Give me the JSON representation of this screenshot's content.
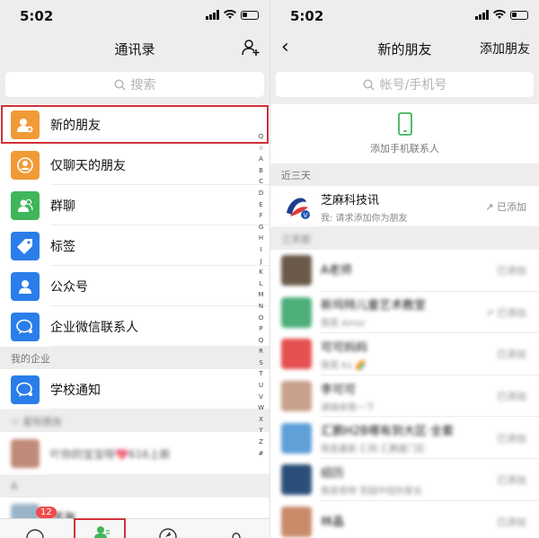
{
  "left": {
    "status_time": "5:02",
    "title": "通讯录",
    "search_placeholder": "搜索",
    "items": [
      {
        "label": "新的朋友",
        "color": "#f19a38"
      },
      {
        "label": "仅聊天的朋友",
        "color": "#f19a38"
      },
      {
        "label": "群聊",
        "color": "#3fb65a"
      },
      {
        "label": "标签",
        "color": "#2b7de9"
      },
      {
        "label": "公众号",
        "color": "#2b7de9"
      },
      {
        "label": "企业微信联系人",
        "color": "#2b7de9"
      }
    ],
    "section_company": "我的企业",
    "company_item": "学校通知",
    "section_starred": "☆ 星标朋友",
    "starred_item": "吖你的宝宝呀💖616上新",
    "section_a": "A",
    "a_item": "洱海",
    "alphabet": [
      "Q",
      "☆",
      "A",
      "B",
      "C",
      "D",
      "E",
      "F",
      "G",
      "H",
      "I",
      "J",
      "K",
      "L",
      "M",
      "N",
      "O",
      "P",
      "Q",
      "R",
      "S",
      "T",
      "U",
      "V",
      "W",
      "X",
      "Y",
      "Z",
      "#"
    ],
    "badge": "12"
  },
  "right": {
    "status_time": "5:02",
    "back": "‹",
    "title": "新的朋友",
    "action": "添加朋友",
    "search_placeholder": "帐号/手机号",
    "add_phone_label": "添加手机联系人",
    "section_recent": "近三天",
    "recent": {
      "name": "芝麻科技讯",
      "msg": "我: 请求添加你为朋友",
      "status": "↗ 已添加"
    },
    "section_older": "三天前",
    "older": [
      {
        "name": "A老师",
        "msg": "",
        "status": "已添加",
        "color": "#6b5a4a"
      },
      {
        "name": "新坞特儿童艺术教室",
        "msg": "我是 Amor",
        "status": "↗ 已添加",
        "color": "#4caf7a"
      },
      {
        "name": "可可妈妈",
        "msg": "我是 Ks 🌈",
        "status": "已添加",
        "color": "#e55050"
      },
      {
        "name": "李可可",
        "msg": "请接收我一下",
        "status": "已添加",
        "color": "#c9a08a"
      },
      {
        "name": "汇鹏H2B哪有到大区·全套",
        "msg": "我是鑫联 汇网 汇鹏厦门区",
        "status": "已添加",
        "color": "#5fa0d8"
      },
      {
        "name": "绍历",
        "msg": "我是菲特 宫园中班的家长",
        "status": "已添加",
        "color": "#2c4f7a"
      },
      {
        "name": "林晶",
        "msg": "",
        "status": "已添加",
        "color": "#c98a6a"
      }
    ]
  }
}
